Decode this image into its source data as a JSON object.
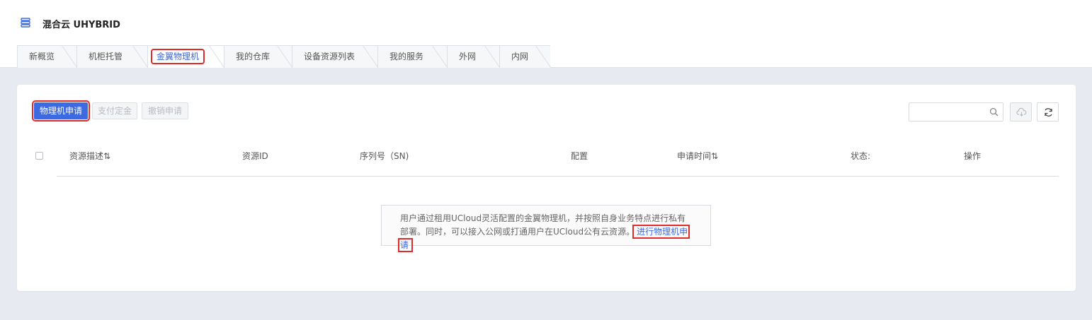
{
  "app": {
    "title": "混合云 UHYBRID",
    "icon": "server-stack-icon"
  },
  "tabs": [
    {
      "label": "新概览"
    },
    {
      "label": "机柜托管"
    },
    {
      "label": "金翼物理机",
      "active": true
    },
    {
      "label": "我的仓库"
    },
    {
      "label": "设备资源列表"
    },
    {
      "label": "我的服务"
    },
    {
      "label": "外网"
    },
    {
      "label": "内网"
    }
  ],
  "toolbar": {
    "apply_label": "物理机申请",
    "pay_label": "支付定金",
    "revoke_label": "撤销申请",
    "search_placeholder": ""
  },
  "table": {
    "columns": [
      "资源描述⇅",
      "资源ID",
      "序列号（SN)",
      "配置",
      "申请时间⇅",
      "状态:",
      "操作"
    ]
  },
  "empty": {
    "text": "用户通过租用UCloud灵活配置的金翼物理机，并按照自身业务特点进行私有部署。同时，可以接入公网或打通用户在UCloud公有云资源。",
    "link": "进行物理机申请"
  },
  "colors": {
    "accent": "#3e6ae1",
    "highlight": "#e02b2b"
  }
}
